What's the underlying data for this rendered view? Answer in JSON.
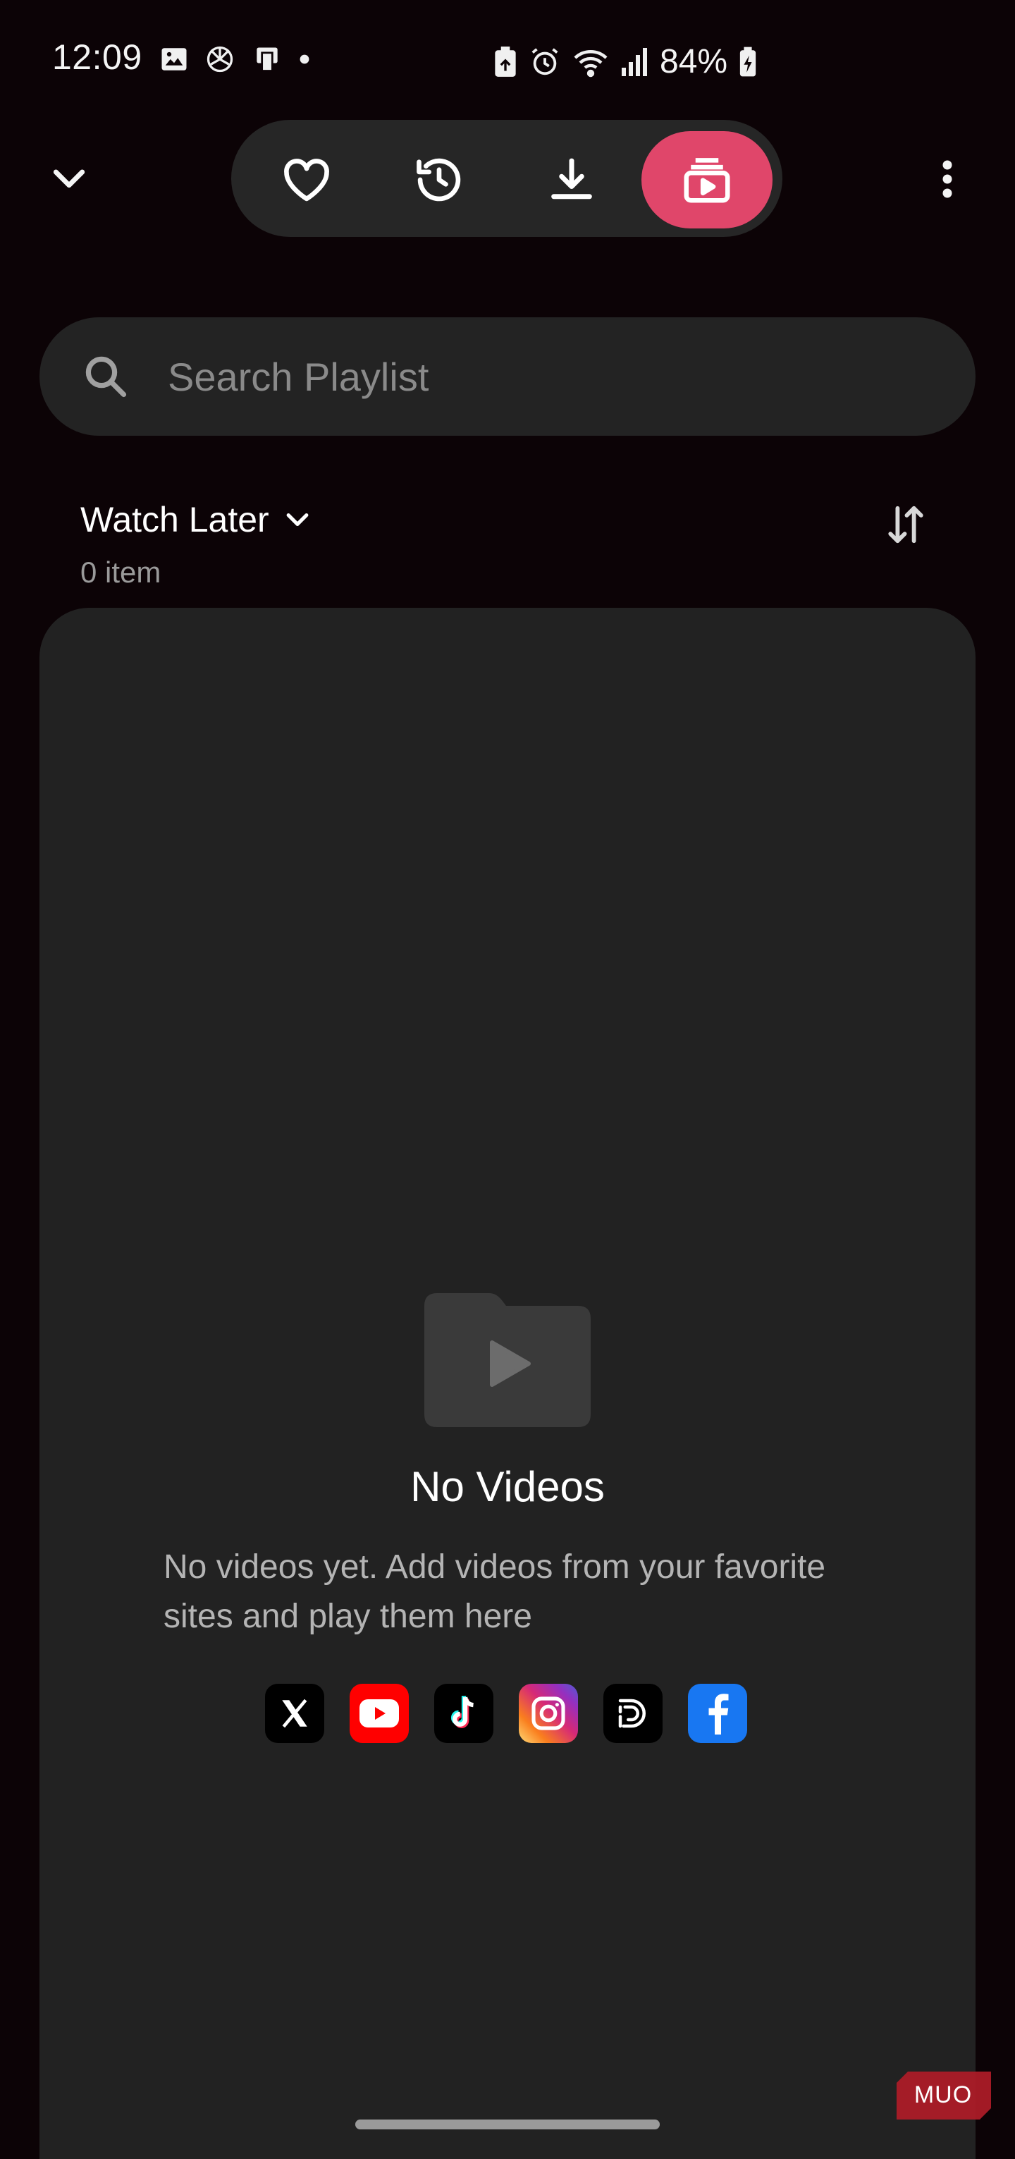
{
  "status_bar": {
    "time": "12:09",
    "battery": "84%",
    "left_icons": [
      "gallery-icon",
      "chatgpt-icon",
      "cast-icon",
      "dot-icon"
    ],
    "right_icons": [
      "battery-saver-icon",
      "alarm-icon",
      "wifi-icon",
      "signal-icon",
      "battery-icon"
    ]
  },
  "toolbar": {
    "buttons": [
      "collapse-icon",
      "heart-icon",
      "history-icon",
      "download-icon",
      "playlist-icon",
      "more-icon"
    ],
    "active": "playlist-icon",
    "accent": "#e0466a"
  },
  "search": {
    "placeholder": "Search Playlist",
    "value": ""
  },
  "playlist": {
    "name": "Watch Later",
    "count": "0 item"
  },
  "empty_state": {
    "title": "No Videos",
    "description": "No videos yet. Add videos from your favorite sites and play them here",
    "sites": [
      "x-icon",
      "youtube-icon",
      "tiktok-icon",
      "instagram-icon",
      "dailymotion-icon",
      "facebook-icon"
    ]
  },
  "watermark": {
    "text": "MUO"
  }
}
